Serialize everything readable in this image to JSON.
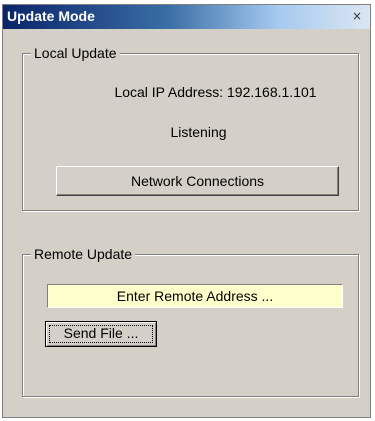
{
  "window": {
    "title": "Update Mode",
    "close_glyph": "×"
  },
  "local_update": {
    "legend": "Local Update",
    "ip_text": "Local IP Address: 192.168.1.101",
    "status": "Listening",
    "network_button_label": "Network Connections"
  },
  "remote_update": {
    "legend": "Remote Update",
    "address_placeholder": "Enter Remote Address ...",
    "send_button_label": "Send File ..."
  },
  "colors": {
    "dialog_bg": "#d4d0c8",
    "title_gradient_start": "#0a246a",
    "title_gradient_end": "#dbe6f2",
    "input_bg": "#ffffcc"
  }
}
